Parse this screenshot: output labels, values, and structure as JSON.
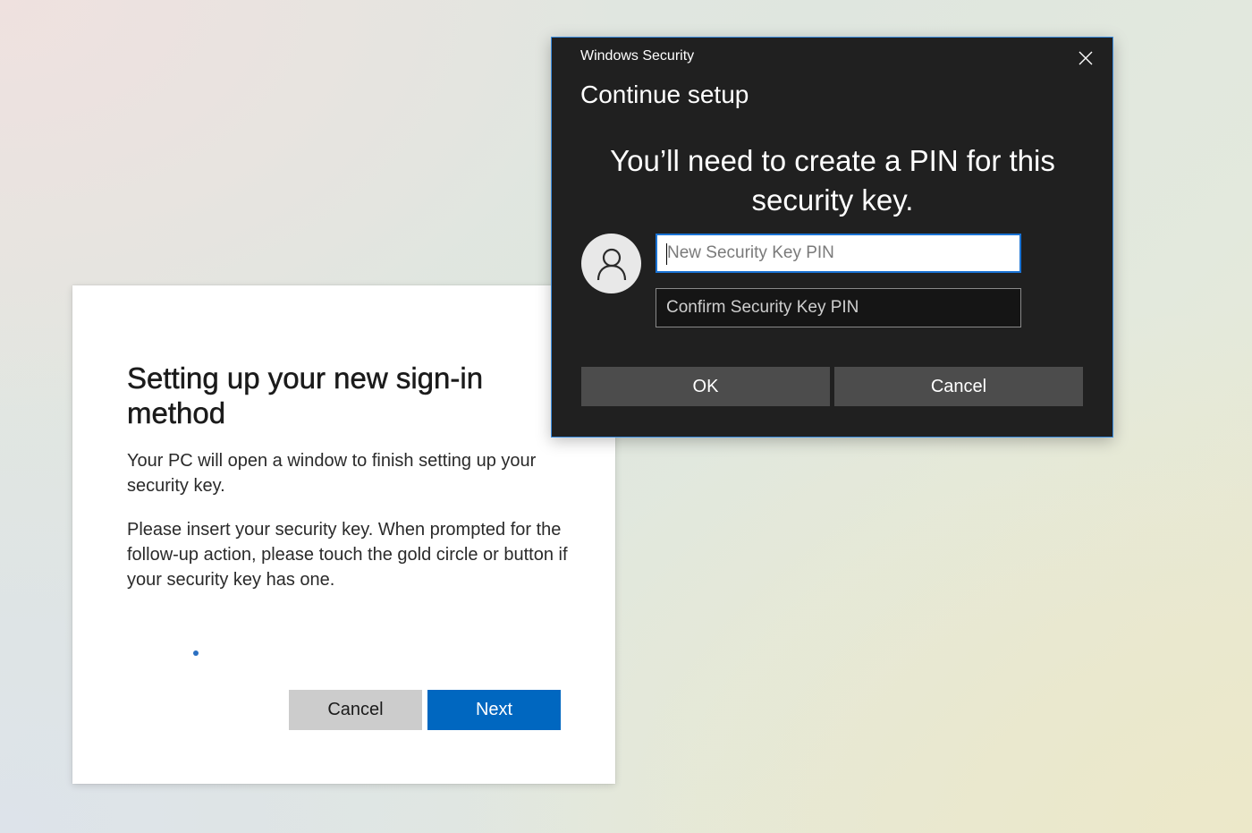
{
  "setup_panel": {
    "title": "Setting up your new sign-in method",
    "paragraph_1": "Your PC will open a window to finish setting up your security key.",
    "paragraph_2": "Please insert your security key. When prompted for the follow-up action, please touch the gold circle or button if your security key has one.",
    "cancel_label": "Cancel",
    "next_label": "Next",
    "accent_color": "#0067c0"
  },
  "security_dialog": {
    "app_title": "Windows Security",
    "heading": "Continue setup",
    "message": "You’ll need to create a PIN for this security key.",
    "avatar_icon": "user-icon",
    "close_icon": "close-icon",
    "new_pin": {
      "value": "",
      "placeholder": "New Security Key PIN"
    },
    "confirm_pin": {
      "value": "",
      "placeholder": "Confirm Security Key PIN"
    },
    "ok_label": "OK",
    "cancel_label": "Cancel",
    "border_color": "#3b8de0",
    "background_color": "#202020"
  }
}
